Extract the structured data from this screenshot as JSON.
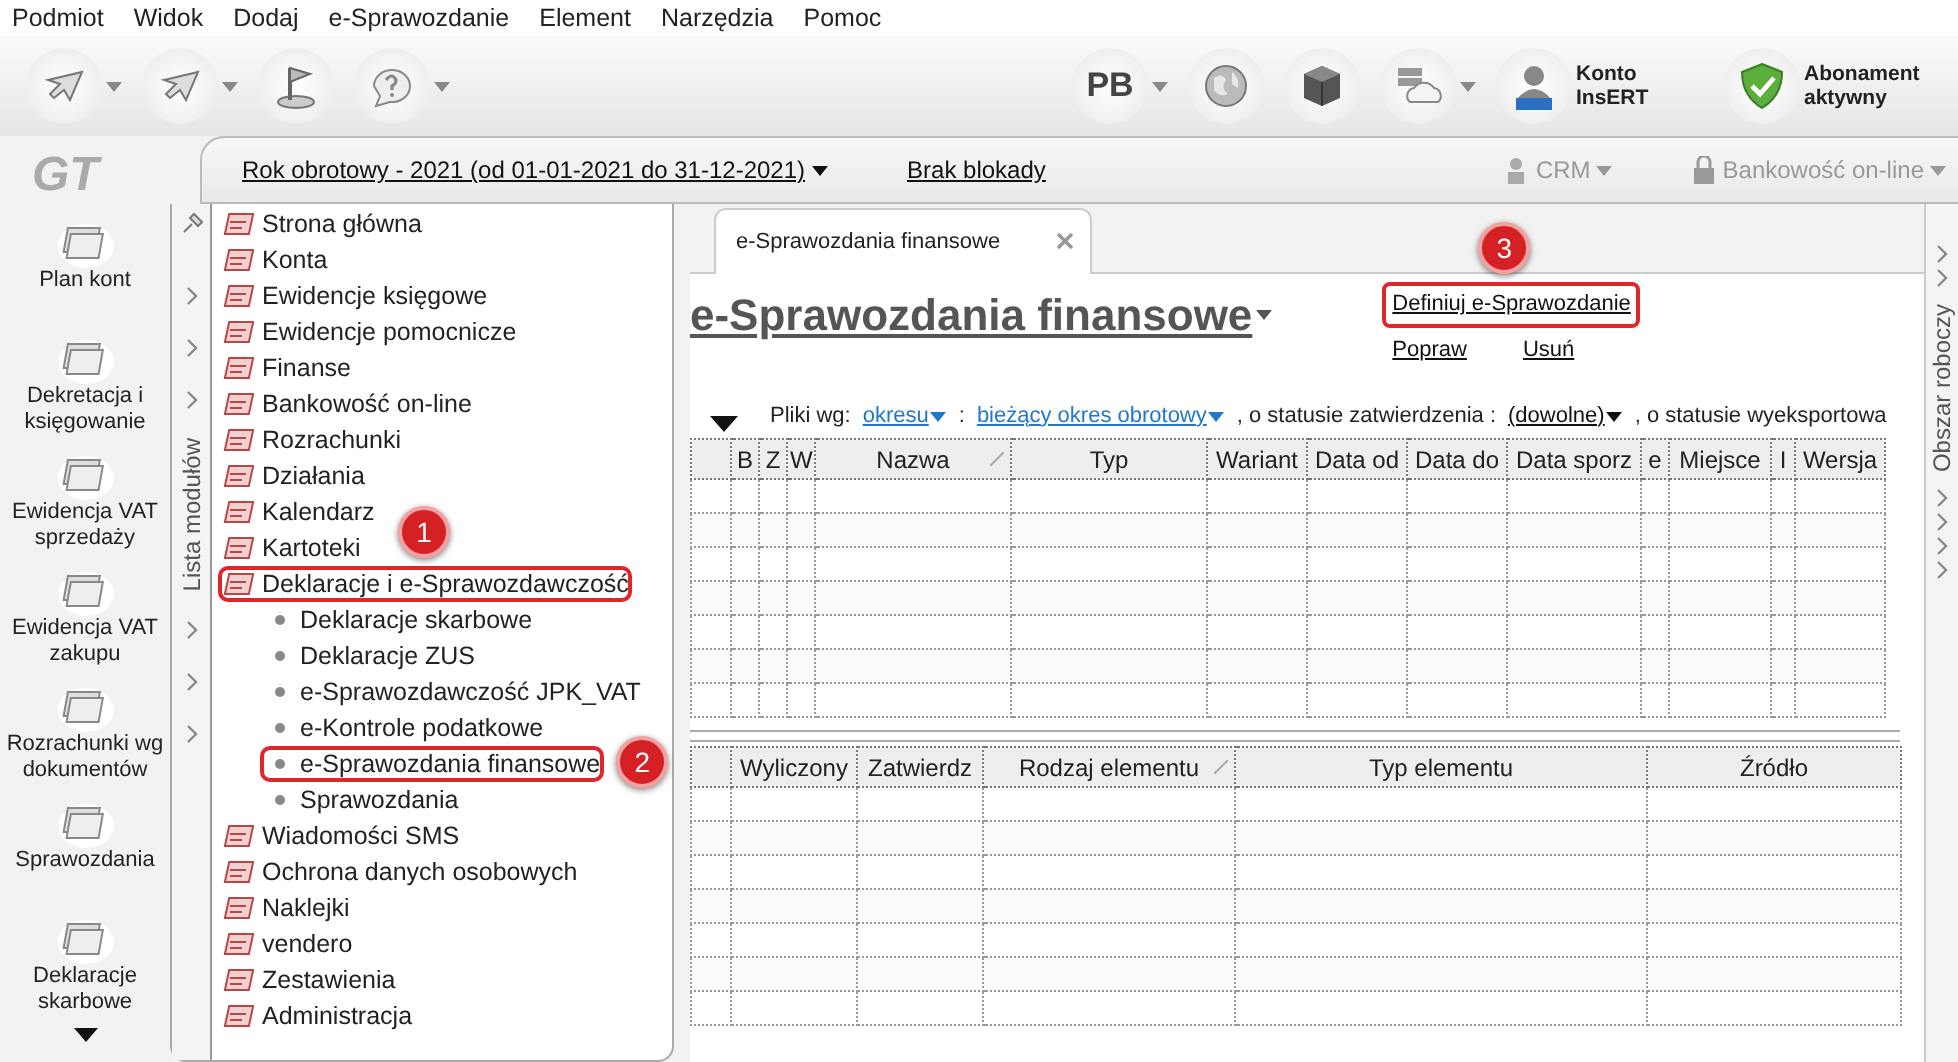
{
  "menu": [
    "Podmiot",
    "Widok",
    "Dodaj",
    "e-Sprawozdanie",
    "Element",
    "Narzędzia",
    "Pomoc"
  ],
  "toolbar": {
    "left": [
      {
        "kind": "arrow",
        "dropdown": true
      },
      {
        "kind": "arrow",
        "dropdown": true
      },
      {
        "kind": "flag",
        "dropdown": false
      },
      {
        "kind": "help",
        "dropdown": true
      }
    ],
    "right": [
      {
        "kind": "text",
        "label": "PB",
        "dropdown": true
      },
      {
        "kind": "globe",
        "dropdown": false
      },
      {
        "kind": "cube",
        "dropdown": false
      },
      {
        "kind": "cloud",
        "dropdown": true
      },
      {
        "kind": "user",
        "label": "Konto InsERT",
        "dropdown": false
      },
      {
        "kind": "shield",
        "label": "Abonament aktywny",
        "dropdown": false
      }
    ]
  },
  "logo": "GT",
  "quick_launch": [
    "Plan kont",
    "Dekretacja i księgowanie",
    "Ewidencja VAT sprzedaży",
    "Ewidencja VAT zakupu",
    "Rozrachunki wg dokumentów",
    "Sprawozdania",
    "Deklaracje skarbowe"
  ],
  "header_bar": {
    "fiscal_year": "Rok obrotowy - 2021  (od 01-01-2021 do 31-12-2021)",
    "lock": "Brak blokady",
    "crm": "CRM",
    "bank": "Bankowość on-line"
  },
  "module_list": {
    "title": "Lista modułów",
    "items": [
      {
        "label": "Strona główna",
        "highlighted": false
      },
      {
        "label": "Konta",
        "highlighted": false
      },
      {
        "label": "Ewidencje księgowe",
        "highlighted": false
      },
      {
        "label": "Ewidencje pomocnicze",
        "highlighted": false
      },
      {
        "label": "Finanse",
        "highlighted": false
      },
      {
        "label": "Bankowość on-line",
        "highlighted": false
      },
      {
        "label": "Rozrachunki",
        "highlighted": false
      },
      {
        "label": "Działania",
        "highlighted": false
      },
      {
        "label": "Kalendarz",
        "highlighted": false
      },
      {
        "label": "Kartoteki",
        "highlighted": false
      },
      {
        "label": "Deklaracje i e-Sprawozdawczość",
        "highlighted": true,
        "callout": "1",
        "children": [
          {
            "label": "Deklaracje skarbowe",
            "highlighted": false
          },
          {
            "label": "Deklaracje ZUS",
            "highlighted": false
          },
          {
            "label": "e-Sprawozdawczość JPK_VAT",
            "highlighted": false
          },
          {
            "label": "e-Kontrole podatkowe",
            "highlighted": false
          },
          {
            "label": "e-Sprawozdania finansowe",
            "highlighted": true,
            "callout": "2"
          },
          {
            "label": "Sprawozdania",
            "highlighted": false
          }
        ]
      },
      {
        "label": "Wiadomości SMS",
        "highlighted": false
      },
      {
        "label": "Ochrona danych osobowych",
        "highlighted": false
      },
      {
        "label": "Naklejki",
        "highlighted": false
      },
      {
        "label": "vendero",
        "highlighted": false
      },
      {
        "label": "Zestawienia",
        "highlighted": false
      },
      {
        "label": "Administracja",
        "highlighted": false
      }
    ]
  },
  "tab": {
    "label": "e-Sprawozdania finansowe",
    "selected": true
  },
  "title": "e-Sprawozdania finansowe",
  "actions": [
    {
      "label": "Definiuj e-Sprawozdanie",
      "highlighted": true,
      "callout": "3"
    },
    {
      "label": "Popraw",
      "highlighted": false
    },
    {
      "label": "Usuń",
      "highlighted": false
    }
  ],
  "filter": [
    {
      "kind": "label",
      "text": "Pliki wg:"
    },
    {
      "kind": "link",
      "text": "okresu"
    },
    {
      "kind": "label",
      "text": ":"
    },
    {
      "kind": "link",
      "text": "bieżący okres obrotowy"
    },
    {
      "kind": "label",
      "text": ", o statusie zatwierdzenia :"
    },
    {
      "kind": "choice",
      "text": "(dowolne)"
    },
    {
      "kind": "label",
      "text": ", o statusie wyeksportowa"
    }
  ],
  "top_table": {
    "columns": [
      {
        "label": "B",
        "sorted": false
      },
      {
        "label": "Z",
        "sorted": false
      },
      {
        "label": "W",
        "sorted": false
      },
      {
        "label": "Nazwa",
        "sorted": true
      },
      {
        "label": "Typ",
        "sorted": false
      },
      {
        "label": "Wariant",
        "sorted": false
      },
      {
        "label": "Data od",
        "sorted": false
      },
      {
        "label": "Data do",
        "sorted": false
      },
      {
        "label": "Data sporz",
        "sorted": false
      },
      {
        "label": "e",
        "sorted": false
      },
      {
        "label": "Miejsce",
        "sorted": false
      },
      {
        "label": "I",
        "sorted": false
      },
      {
        "label": "Wersja",
        "sorted": false
      }
    ]
  },
  "bottom_table": {
    "columns": [
      {
        "label": "Wyliczony",
        "sorted": false
      },
      {
        "label": "Zatwierdz",
        "sorted": false
      },
      {
        "label": "Rodzaj elementu",
        "sorted": true
      },
      {
        "label": "Typ elementu",
        "sorted": false
      },
      {
        "label": "Źródło",
        "sorted": false
      }
    ]
  },
  "work_area": "Obszar roboczy"
}
